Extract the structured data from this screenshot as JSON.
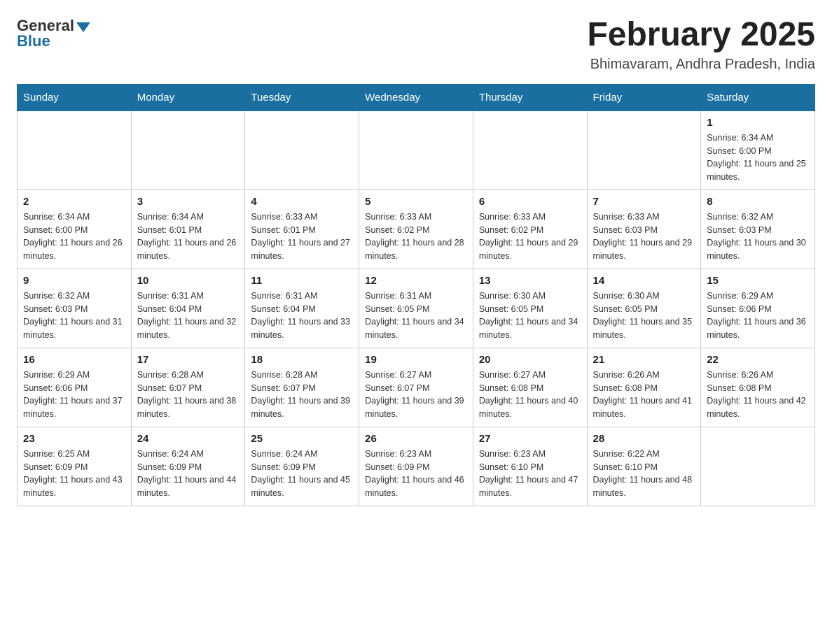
{
  "logo": {
    "general": "General",
    "blue": "Blue"
  },
  "header": {
    "month_year": "February 2025",
    "location": "Bhimavaram, Andhra Pradesh, India"
  },
  "days_of_week": [
    "Sunday",
    "Monday",
    "Tuesday",
    "Wednesday",
    "Thursday",
    "Friday",
    "Saturday"
  ],
  "weeks": [
    [
      {
        "day": "",
        "info": ""
      },
      {
        "day": "",
        "info": ""
      },
      {
        "day": "",
        "info": ""
      },
      {
        "day": "",
        "info": ""
      },
      {
        "day": "",
        "info": ""
      },
      {
        "day": "",
        "info": ""
      },
      {
        "day": "1",
        "info": "Sunrise: 6:34 AM\nSunset: 6:00 PM\nDaylight: 11 hours and 25 minutes."
      }
    ],
    [
      {
        "day": "2",
        "info": "Sunrise: 6:34 AM\nSunset: 6:00 PM\nDaylight: 11 hours and 26 minutes."
      },
      {
        "day": "3",
        "info": "Sunrise: 6:34 AM\nSunset: 6:01 PM\nDaylight: 11 hours and 26 minutes."
      },
      {
        "day": "4",
        "info": "Sunrise: 6:33 AM\nSunset: 6:01 PM\nDaylight: 11 hours and 27 minutes."
      },
      {
        "day": "5",
        "info": "Sunrise: 6:33 AM\nSunset: 6:02 PM\nDaylight: 11 hours and 28 minutes."
      },
      {
        "day": "6",
        "info": "Sunrise: 6:33 AM\nSunset: 6:02 PM\nDaylight: 11 hours and 29 minutes."
      },
      {
        "day": "7",
        "info": "Sunrise: 6:33 AM\nSunset: 6:03 PM\nDaylight: 11 hours and 29 minutes."
      },
      {
        "day": "8",
        "info": "Sunrise: 6:32 AM\nSunset: 6:03 PM\nDaylight: 11 hours and 30 minutes."
      }
    ],
    [
      {
        "day": "9",
        "info": "Sunrise: 6:32 AM\nSunset: 6:03 PM\nDaylight: 11 hours and 31 minutes."
      },
      {
        "day": "10",
        "info": "Sunrise: 6:31 AM\nSunset: 6:04 PM\nDaylight: 11 hours and 32 minutes."
      },
      {
        "day": "11",
        "info": "Sunrise: 6:31 AM\nSunset: 6:04 PM\nDaylight: 11 hours and 33 minutes."
      },
      {
        "day": "12",
        "info": "Sunrise: 6:31 AM\nSunset: 6:05 PM\nDaylight: 11 hours and 34 minutes."
      },
      {
        "day": "13",
        "info": "Sunrise: 6:30 AM\nSunset: 6:05 PM\nDaylight: 11 hours and 34 minutes."
      },
      {
        "day": "14",
        "info": "Sunrise: 6:30 AM\nSunset: 6:05 PM\nDaylight: 11 hours and 35 minutes."
      },
      {
        "day": "15",
        "info": "Sunrise: 6:29 AM\nSunset: 6:06 PM\nDaylight: 11 hours and 36 minutes."
      }
    ],
    [
      {
        "day": "16",
        "info": "Sunrise: 6:29 AM\nSunset: 6:06 PM\nDaylight: 11 hours and 37 minutes."
      },
      {
        "day": "17",
        "info": "Sunrise: 6:28 AM\nSunset: 6:07 PM\nDaylight: 11 hours and 38 minutes."
      },
      {
        "day": "18",
        "info": "Sunrise: 6:28 AM\nSunset: 6:07 PM\nDaylight: 11 hours and 39 minutes."
      },
      {
        "day": "19",
        "info": "Sunrise: 6:27 AM\nSunset: 6:07 PM\nDaylight: 11 hours and 39 minutes."
      },
      {
        "day": "20",
        "info": "Sunrise: 6:27 AM\nSunset: 6:08 PM\nDaylight: 11 hours and 40 minutes."
      },
      {
        "day": "21",
        "info": "Sunrise: 6:26 AM\nSunset: 6:08 PM\nDaylight: 11 hours and 41 minutes."
      },
      {
        "day": "22",
        "info": "Sunrise: 6:26 AM\nSunset: 6:08 PM\nDaylight: 11 hours and 42 minutes."
      }
    ],
    [
      {
        "day": "23",
        "info": "Sunrise: 6:25 AM\nSunset: 6:09 PM\nDaylight: 11 hours and 43 minutes."
      },
      {
        "day": "24",
        "info": "Sunrise: 6:24 AM\nSunset: 6:09 PM\nDaylight: 11 hours and 44 minutes."
      },
      {
        "day": "25",
        "info": "Sunrise: 6:24 AM\nSunset: 6:09 PM\nDaylight: 11 hours and 45 minutes."
      },
      {
        "day": "26",
        "info": "Sunrise: 6:23 AM\nSunset: 6:09 PM\nDaylight: 11 hours and 46 minutes."
      },
      {
        "day": "27",
        "info": "Sunrise: 6:23 AM\nSunset: 6:10 PM\nDaylight: 11 hours and 47 minutes."
      },
      {
        "day": "28",
        "info": "Sunrise: 6:22 AM\nSunset: 6:10 PM\nDaylight: 11 hours and 48 minutes."
      },
      {
        "day": "",
        "info": ""
      }
    ]
  ]
}
